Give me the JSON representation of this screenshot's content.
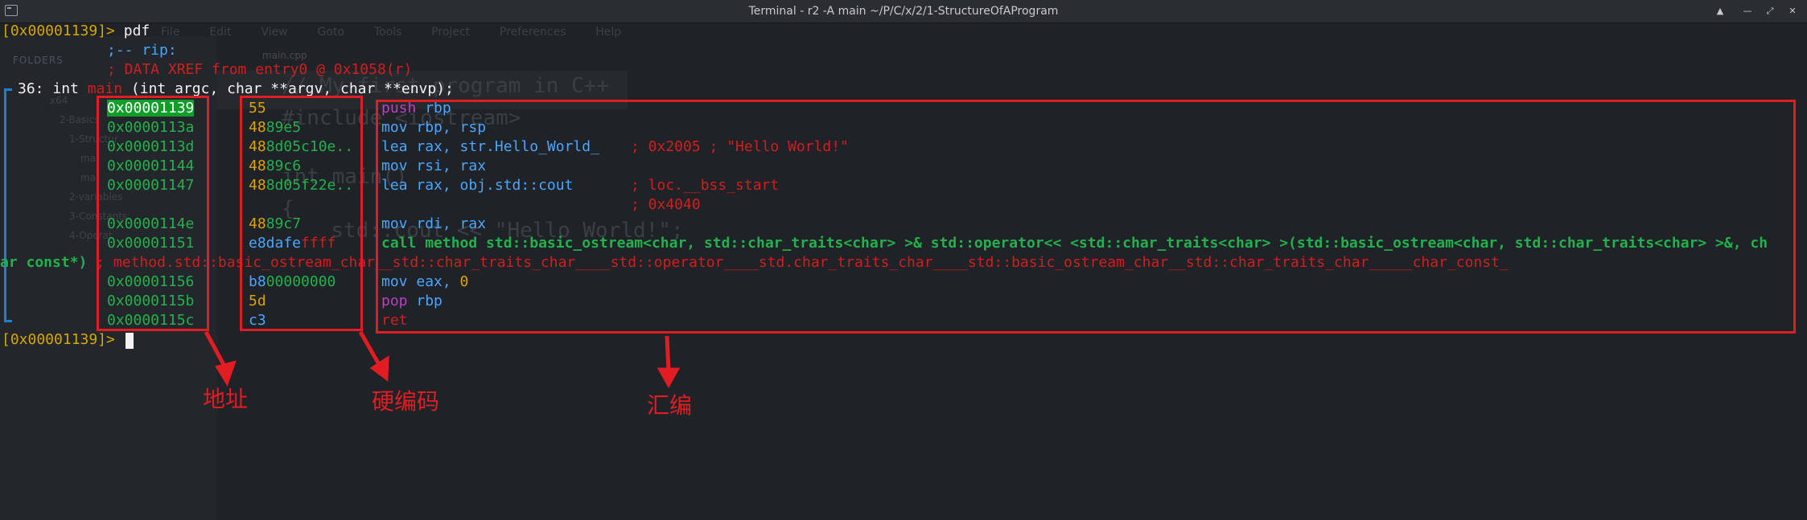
{
  "window": {
    "title": "Terminal - r2 -A main ~/P/C/x/2/1-StructureOfAProgram",
    "buttons": [
      "▲",
      "—",
      "⤢",
      "✕"
    ]
  },
  "background_editor": {
    "menu": "File  Edit  View  Goto  Tools  Project  Preferences  Help",
    "folders_label": "FOLDERS",
    "tab": "main.cpp",
    "tree": [
      "x64",
      "2-Basics",
      "1-Structur",
      "ma",
      "ma",
      "2-variables",
      "3-Constants",
      "4-Operat"
    ],
    "code": [
      "// My first program in C++",
      "#include <iostream>",
      "int main()",
      "{",
      "  std::cout << \"Hello World!\";"
    ]
  },
  "terminal": {
    "prompt": "[0x00001139]>",
    "command": "pdf",
    "rip_comment": ";-- rip:",
    "xref_comment": "; DATA XREF from entry0 @ 0x1058(r)",
    "func_size": "36:",
    "func_sig_prefix": "int ",
    "func_name": "main",
    "func_sig_suffix": " (int argc, char **argv, char **envp);",
    "wrap_prefix": "ar const*)",
    "wrap_comment": "; method.std::basic_ostream_char__std::char_traits_char____std::operator____std.char_traits_char____std::basic_ostream_char__std::char_traits_char_____char_const_",
    "rows": [
      {
        "addr": "0x00001139",
        "bytes_a": "55",
        "bytes_b": "",
        "mnemonic": "push",
        "operands": " rbp",
        "comment": ""
      },
      {
        "addr": "0x0000113a",
        "bytes_a": "48",
        "bytes_b": "89e5",
        "mnemonic": "mov",
        "operands": " rbp, rsp",
        "comment": ""
      },
      {
        "addr": "0x0000113d",
        "bytes_a": "48",
        "bytes_b": "8d05c10e..",
        "mnemonic": "lea",
        "operands": " rax, str.Hello_World_",
        "comment": "; 0x2005 ; \"Hello World!\""
      },
      {
        "addr": "0x00001144",
        "bytes_a": "48",
        "bytes_b": "89c6",
        "mnemonic": "mov",
        "operands": " rsi, rax",
        "comment": ""
      },
      {
        "addr": "0x00001147",
        "bytes_a": "48",
        "bytes_b": "8d05f22e..",
        "mnemonic": "lea",
        "operands": " rax, obj.std::cout",
        "comment": "; loc.__bss_start"
      },
      {
        "addr": "",
        "bytes_a": "",
        "bytes_b": "",
        "mnemonic": "",
        "operands": "",
        "comment": "; 0x4040"
      },
      {
        "addr": "0x0000114e",
        "bytes_a": "48",
        "bytes_b": "89c7",
        "mnemonic": "mov",
        "operands": " rdi, rax",
        "comment": ""
      },
      {
        "addr": "0x00001151",
        "bytes_a": "e8dafe",
        "bytes_b": "ffff",
        "mnemonic": "call",
        "operands": " method std::basic_ostream<char, std::char_traits<char> >& std::operator<< <std::char_traits<char> >(std::basic_ostream<char, std::char_traits<char> >&, ch",
        "comment": ""
      },
      {
        "addr": "",
        "bytes_a": "",
        "bytes_b": "",
        "mnemonic": "",
        "operands": "",
        "comment": ""
      },
      {
        "addr": "0x00001156",
        "bytes_a": "b8",
        "bytes_b": "00000000",
        "mnemonic": "mov",
        "operands": " eax, ",
        "imm": "0",
        "comment": ""
      },
      {
        "addr": "0x0000115b",
        "bytes_a": "5d",
        "bytes_b": "",
        "mnemonic": "pop",
        "operands": " rbp",
        "comment": ""
      },
      {
        "addr": "0x0000115c",
        "bytes_a": "c3",
        "bytes_b": "",
        "mnemonic": "ret",
        "operands": "",
        "comment": ""
      }
    ]
  },
  "annotations": {
    "address_label": "地址",
    "machine_code_label": "硬编码",
    "assembly_label": "汇编",
    "color": "#e11c22"
  }
}
